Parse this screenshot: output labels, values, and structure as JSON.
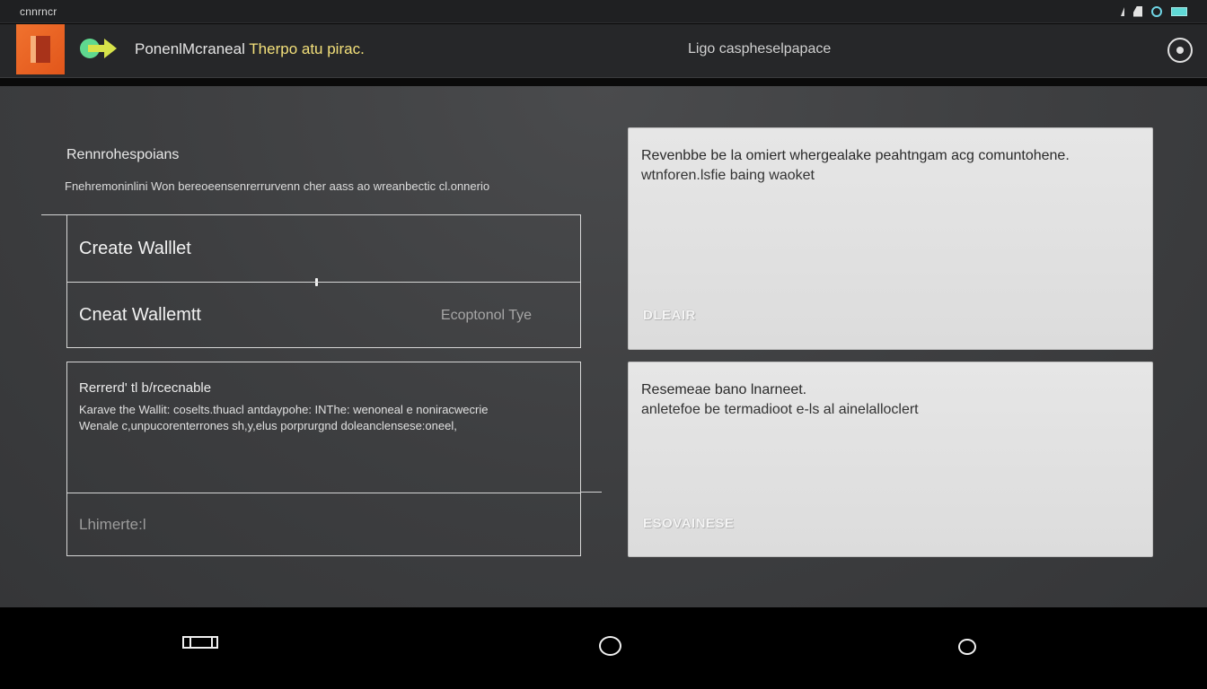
{
  "status_bar": {
    "carrier": "cnnrncr",
    "icons": [
      "signal-icon",
      "wifi-icon",
      "sync-icon",
      "battery-icon"
    ]
  },
  "app_bar": {
    "logo": "app-logo",
    "nav_icon": "forward-arrow-icon",
    "title_prefix": "PonenlMcraneal ",
    "title_accent": "Therpo atu pirac.",
    "subtitle": "Ligo caspheselpapace",
    "action_icon": "eye-icon"
  },
  "main": {
    "section_title": "Rennrohespoians",
    "section_desc": "Fnehremoninlini Won bereoeensenrerrurvenn cher aass ao wreanbectic cl.onnerio",
    "options": [
      {
        "label": "Create Walllet",
        "hint": ""
      },
      {
        "label": "Cneat Wallemtt",
        "hint": "Ecoptonol Tye"
      }
    ],
    "restore": {
      "title": "Rerrerd' tl b/rcecnable",
      "lines": [
        "Karave the Wallit: coselts.thuacl antdaypohe: INThe: wenoneal e noniracwecrie",
        "Wenale c,unpucorenterrones sh,y,elus porprurgnd doleanclensese:oneel,"
      ],
      "footer": "Lhimerte:l"
    },
    "cards": [
      {
        "title": "Revenbbe be la omiert whergealake peahtngam acg comuntohene.",
        "text": "wtnforen.lsfie baing waoket",
        "action": "DLEAIR"
      },
      {
        "title": "Resemeae bano lnarneet.",
        "text": "anletefoe be termadioot e-ls al ainelalloclert",
        "action": "ESOVAINESE"
      }
    ]
  },
  "bottom_nav": {
    "buttons": [
      "recent-apps-icon",
      "home-icon",
      "back-icon"
    ]
  },
  "colors": {
    "status_bar_bg": "#1f2022",
    "app_bar_bg": "#262729",
    "main_bg": "#3d3e40",
    "card_bg": "#e3e3e3",
    "logo_orange": "#e8642a",
    "title_accent": "#f3e07a",
    "battery": "#5fd9d6"
  }
}
